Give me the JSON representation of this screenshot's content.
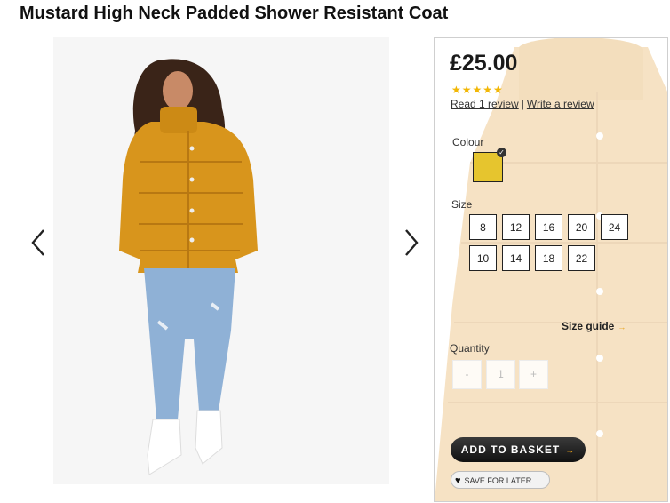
{
  "product": {
    "title": "Mustard High Neck Padded Shower Resistant Coat",
    "price": "£25.00",
    "rating_stars": "★★★★★",
    "rating_value": 5,
    "read_reviews_label": "Read 1 review",
    "review_separator": "|",
    "write_review_label": "Write a review"
  },
  "gallery": {
    "image_alt": "Model wearing mustard high neck padded coat with ripped jeans and white boots",
    "prev_icon": "chevron-left-icon",
    "next_icon": "chevron-right-icon"
  },
  "colour": {
    "label": "Colour",
    "selected_swatch": "#e6c52e"
  },
  "size": {
    "label": "Size",
    "options": [
      "8",
      "12",
      "16",
      "20",
      "24",
      "10",
      "14",
      "18",
      "22"
    ],
    "guide_label": "Size guide",
    "guide_arrow": "→"
  },
  "quantity": {
    "label": "Quantity",
    "decrement": "-",
    "value": "1",
    "increment": "+"
  },
  "actions": {
    "add_to_basket_label": "ADD TO BASKET",
    "add_to_basket_arrow": "→",
    "save_for_later_label": "SAVE FOR LATER"
  },
  "colors": {
    "accent": "#e8a21a",
    "mustard": "#d8951c",
    "star": "#f2b705"
  }
}
